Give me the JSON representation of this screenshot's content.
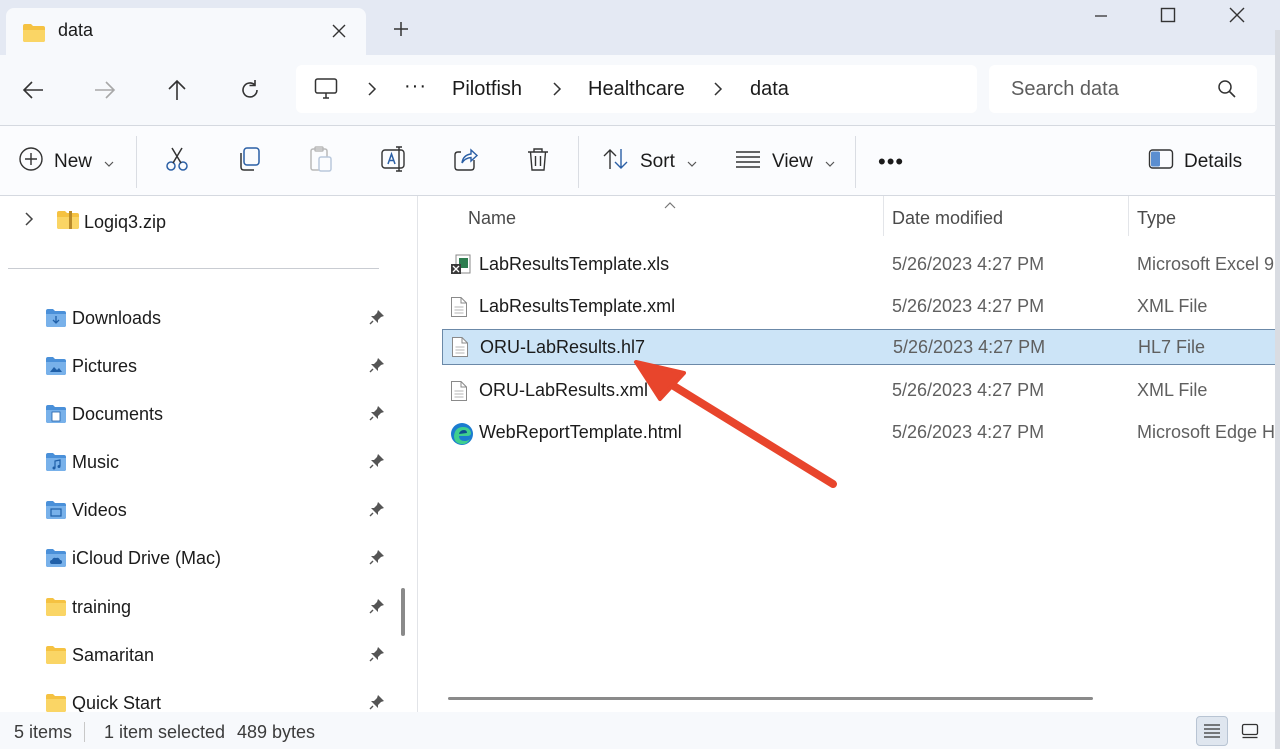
{
  "window": {
    "tab_title": "data",
    "new_tab_symbol": "+"
  },
  "breadcrumb": {
    "more": "···",
    "items": [
      "Pilotfish",
      "Healthcare",
      "data"
    ]
  },
  "search": {
    "placeholder": "Search data"
  },
  "toolbar": {
    "new_label": "New",
    "sort_label": "Sort",
    "view_label": "View",
    "more_label": "•••",
    "details_label": "Details"
  },
  "sidebar": {
    "top_item": "Logiq3.zip",
    "items": [
      {
        "label": "Downloads",
        "icon": "downloads-folder-icon"
      },
      {
        "label": "Pictures",
        "icon": "pictures-folder-icon"
      },
      {
        "label": "Documents",
        "icon": "documents-folder-icon"
      },
      {
        "label": "Music",
        "icon": "music-folder-icon"
      },
      {
        "label": "Videos",
        "icon": "videos-folder-icon"
      },
      {
        "label": "iCloud Drive (Mac)",
        "icon": "cloud-folder-icon"
      },
      {
        "label": "training",
        "icon": "folder-icon"
      },
      {
        "label": "Samaritan",
        "icon": "folder-icon"
      },
      {
        "label": "Quick Start",
        "icon": "folder-icon"
      }
    ]
  },
  "file_list": {
    "columns": {
      "name": "Name",
      "date": "Date modified",
      "type": "Type"
    },
    "rows": [
      {
        "name": "LabResultsTemplate.xls",
        "date": "5/26/2023 4:27 PM",
        "type": "Microsoft Excel 9",
        "icon": "excel-file-icon",
        "selected": false
      },
      {
        "name": "LabResultsTemplate.xml",
        "date": "5/26/2023 4:27 PM",
        "type": "XML File",
        "icon": "document-file-icon",
        "selected": false
      },
      {
        "name": "ORU-LabResults.hl7",
        "date": "5/26/2023 4:27 PM",
        "type": "HL7 File",
        "icon": "document-file-icon",
        "selected": true
      },
      {
        "name": "ORU-LabResults.xml",
        "date": "5/26/2023 4:27 PM",
        "type": "XML File",
        "icon": "document-file-icon",
        "selected": false
      },
      {
        "name": "WebReportTemplate.html",
        "date": "5/26/2023 4:27 PM",
        "type": "Microsoft Edge H",
        "icon": "edge-file-icon",
        "selected": false
      }
    ]
  },
  "status": {
    "item_count": "5 items",
    "selection": "1 item selected",
    "size": "489 bytes"
  },
  "colors": {
    "selection_bg": "#cce4f7",
    "selection_border": "#6b89a8",
    "folder_yellow": "#f5c242",
    "folder_blue": "#4a90d9",
    "annotation_arrow": "#e8452c"
  }
}
